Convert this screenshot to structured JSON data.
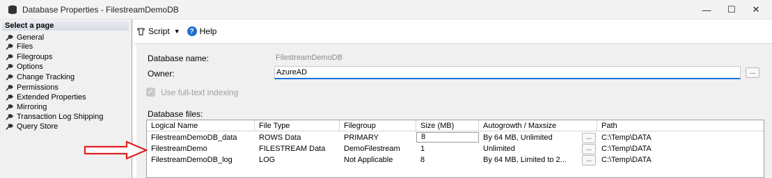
{
  "window": {
    "title": "Database Properties - FilestreamDemoDB",
    "minimize_glyph": "—",
    "maximize_glyph": "☐",
    "close_glyph": "✕"
  },
  "sidebar": {
    "header": "Select a page",
    "items": [
      {
        "label": "General"
      },
      {
        "label": "Files"
      },
      {
        "label": "Filegroups"
      },
      {
        "label": "Options"
      },
      {
        "label": "Change Tracking"
      },
      {
        "label": "Permissions"
      },
      {
        "label": "Extended Properties"
      },
      {
        "label": "Mirroring"
      },
      {
        "label": "Transaction Log Shipping"
      },
      {
        "label": "Query Store"
      }
    ]
  },
  "toolbar": {
    "script_label": "Script",
    "caret": "▼",
    "help_label": "Help",
    "help_glyph": "?"
  },
  "form": {
    "dbname_label": "Database name:",
    "dbname_value": "FilestreamDemoDB",
    "owner_label": "Owner:",
    "owner_value": "AzureAD",
    "fulltext_label": "Use full-text indexing",
    "fulltext_checked": true,
    "ellipsis": "...",
    "checkmark": "✓",
    "dbfiles_label": "Database files:"
  },
  "files_table": {
    "columns": [
      "Logical Name",
      "File Type",
      "Filegroup",
      "Size (MB)",
      "Autogrowth / Maxsize",
      "Path"
    ],
    "rows": [
      {
        "logical_name": "FilestreamDemoDB_data",
        "file_type": "ROWS Data",
        "filegroup": "PRIMARY",
        "size": "8",
        "autogrowth": "By 64 MB, Unlimited",
        "path": "C:\\Temp\\DATA"
      },
      {
        "logical_name": "FilestreamDemo",
        "file_type": "FILESTREAM Data",
        "filegroup": "DemoFilestream",
        "size": "1",
        "autogrowth": "Unlimited",
        "path": "C:\\Temp\\DATA"
      },
      {
        "logical_name": "FilestreamDemoDB_log",
        "file_type": "LOG",
        "filegroup": "Not Applicable",
        "size": "8",
        "autogrowth": "By 64 MB, Limited to 2...",
        "path": "C:\\Temp\\DATA"
      }
    ]
  },
  "colors": {
    "accent": "#1e6fd9",
    "annotation_arrow": "#e02020"
  }
}
